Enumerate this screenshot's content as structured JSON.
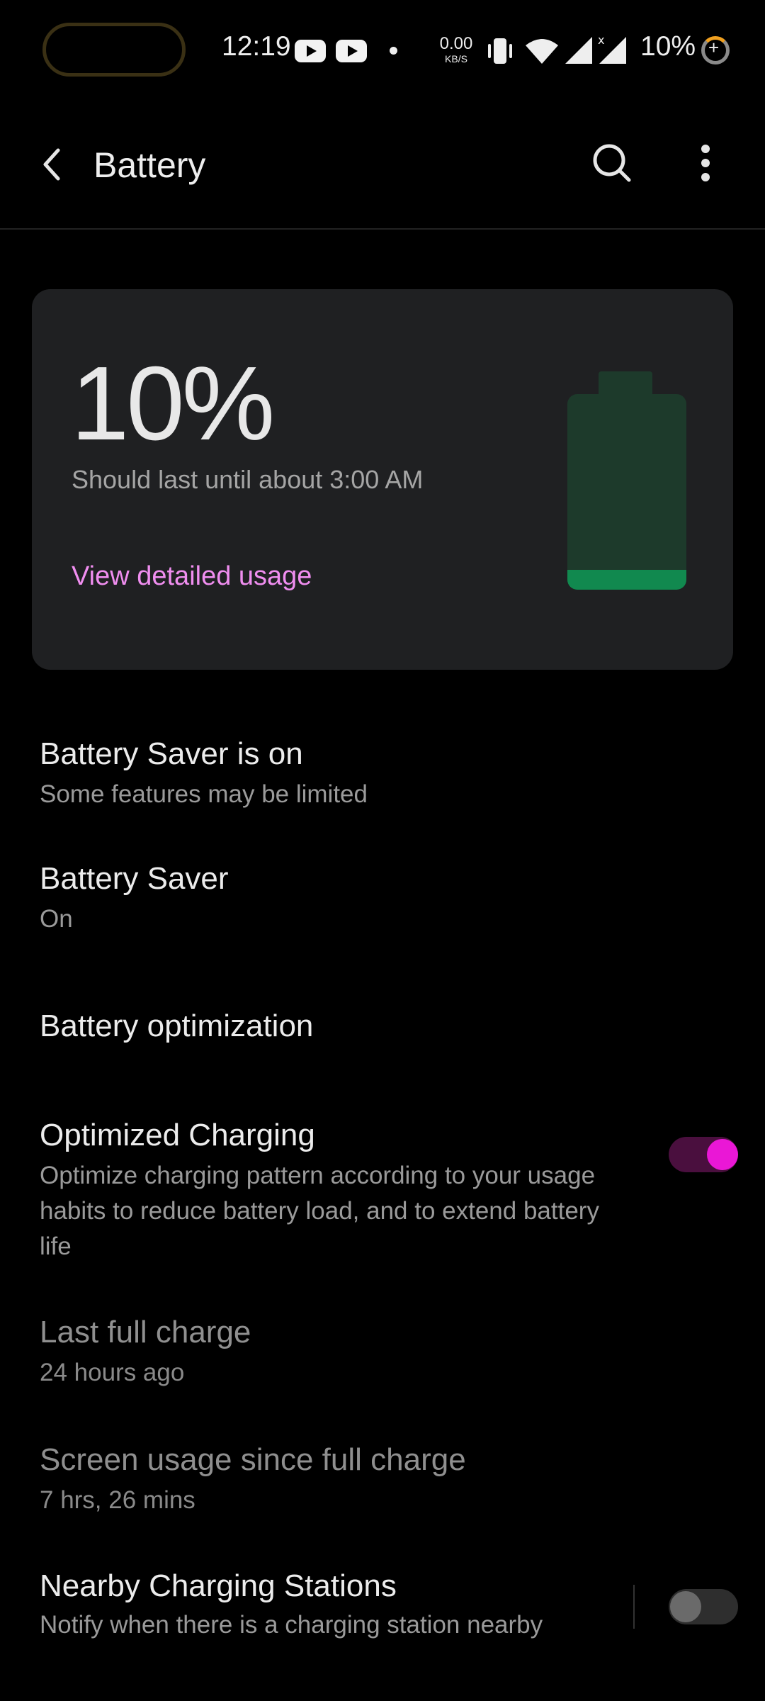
{
  "status_bar": {
    "time": "12:19",
    "net_speed_value": "0.00",
    "net_speed_unit": "KB/S",
    "battery_percent": "10%"
  },
  "app_bar": {
    "title": "Battery"
  },
  "battery_card": {
    "percent": "10%",
    "level": 0.1,
    "estimate": "Should last until about 3:00 AM",
    "link": "View detailed usage",
    "fill_color": "#11894f",
    "empty_color": "#1d3a2b"
  },
  "settings": [
    {
      "title": "Battery Saver is on",
      "subtitle": "Some features may be limited"
    },
    {
      "title": "Battery Saver",
      "subtitle": "On"
    },
    {
      "title": "Battery optimization"
    },
    {
      "title": "Optimized Charging",
      "subtitle": "Optimize charging pattern according to your usage habits to reduce battery load, and to extend battery life",
      "toggle": true
    },
    {
      "title": "Last full charge",
      "subtitle": "24 hours ago"
    },
    {
      "title": "Screen usage since full charge",
      "subtitle": "7 hrs, 26 mins"
    },
    {
      "title": "Nearby Charging Stations",
      "subtitle": "Notify when there is a charging station nearby",
      "toggle": false
    }
  ],
  "colors": {
    "accent": "#ea17d6",
    "link": "#f08ef0",
    "card_bg": "#1f2022"
  }
}
